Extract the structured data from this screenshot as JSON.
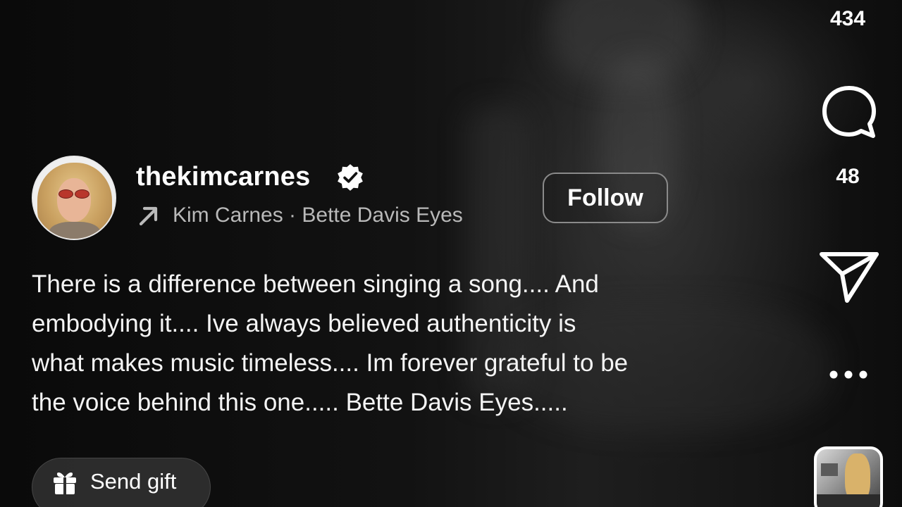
{
  "post": {
    "username": "thekimcarnes",
    "music_label": "Kim Carnes · Bette Davis Eyes",
    "follow_label": "Follow",
    "caption_lines": [
      "There is a difference between singing a song.... And",
      "embodying it.... Ive always believed authenticity is",
      "what makes music timeless.... Im forever grateful to be",
      "the voice behind this one..... Bette Davis Eyes....."
    ],
    "gift_label": "Send gift"
  },
  "actions": {
    "like_count": "434",
    "comment_count": "48"
  },
  "icons": {
    "verified": "verified-badge-icon",
    "music": "arrow-up-right-icon",
    "gift": "gift-icon",
    "comment": "comment-bubble-icon",
    "share": "paper-plane-icon",
    "more": "more-dots-icon"
  },
  "colors": {
    "background": "#0b0b0b",
    "text": "#ffffff",
    "secondary_text": "#b9b9b9",
    "follow_border": "#8a8a8a"
  }
}
